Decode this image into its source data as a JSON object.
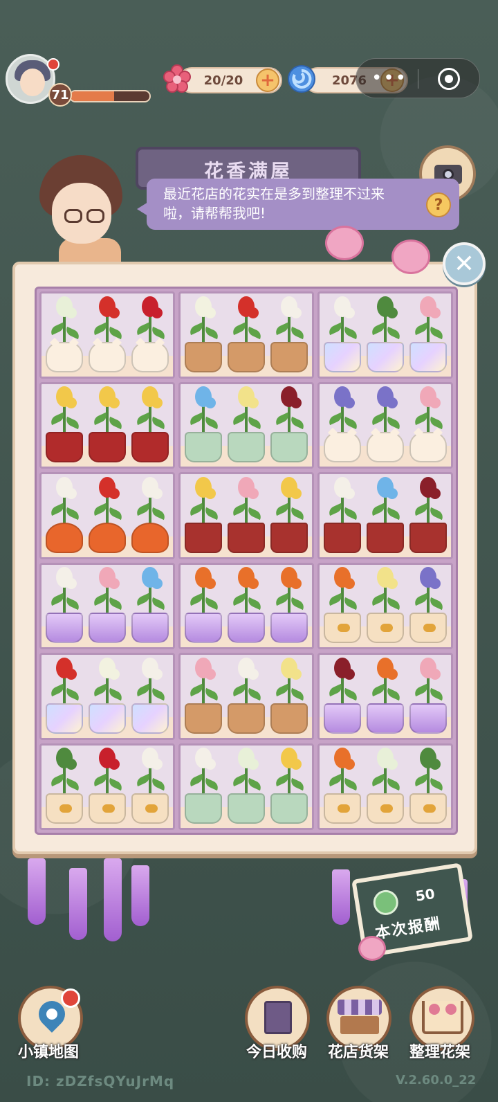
{
  "player": {
    "level": "71",
    "xp_fraction": 0.55
  },
  "resources": {
    "stamina": {
      "value": "20/20",
      "icon": "pink-flower-icon"
    },
    "currency": {
      "value": "2076",
      "icon": "blue-swirl-icon"
    }
  },
  "capsule": {
    "more_icon": "more-dots-icon",
    "close_icon": "target-icon"
  },
  "shop": {
    "title": "花香满屋"
  },
  "dialog": {
    "text": "最近花店的花实在是多到整理不过来啦，请帮帮我吧!"
  },
  "reward": {
    "value": "50",
    "label": "本次报酬"
  },
  "nav": {
    "map": "小镇地图",
    "purchase": "今日收购",
    "shelf": "花店货架",
    "organize": "整理花架"
  },
  "footer": {
    "id": "ID: zDZfsQYuJrMq",
    "version": "V.2.60.0_22"
  },
  "colors": {
    "panel_bg": "#f7eadc",
    "grid_bg": "#c7a3c7",
    "bubble": "#a48fc6"
  },
  "shelf": [
    [
      {
        "flower": "#e8f0d8",
        "pot": "cat"
      },
      {
        "flower": "#d4302a",
        "pot": "cat"
      },
      {
        "flower": "#c8202c",
        "pot": "cat"
      }
    ],
    [
      {
        "flower": "#f2f2e0",
        "pot": "clay"
      },
      {
        "flower": "#d4302a",
        "pot": "clay"
      },
      {
        "flower": "#f4f0e8",
        "pot": "clay"
      }
    ],
    [
      {
        "flower": "#f4f0e8",
        "pot": "glass"
      },
      {
        "flower": "#4f8a3e",
        "pot": "glass"
      },
      {
        "flower": "#f0a8b8",
        "pot": "glass"
      }
    ],
    [
      {
        "flower": "#f2c84a",
        "pot": "red"
      },
      {
        "flower": "#f2c84a",
        "pot": "red"
      },
      {
        "flower": "#f2c84a",
        "pot": "red"
      }
    ],
    [
      {
        "flower": "#6fb4e8",
        "pot": "jade"
      },
      {
        "flower": "#f2e28a",
        "pot": "jade"
      },
      {
        "flower": "#8a1f2a",
        "pot": "jade"
      }
    ],
    [
      {
        "flower": "#7a72c8",
        "pot": "cat"
      },
      {
        "flower": "#7a72c8",
        "pot": "cat"
      },
      {
        "flower": "#f0a8b8",
        "pot": "cat"
      }
    ],
    [
      {
        "flower": "#f4f0e8",
        "pot": "fire"
      },
      {
        "flower": "#d4302a",
        "pot": "fire"
      },
      {
        "flower": "#f4f0e8",
        "pot": "fire"
      }
    ],
    [
      {
        "flower": "#f2c84a",
        "pot": "terracotta"
      },
      {
        "flower": "#f0a8b8",
        "pot": "terracotta"
      },
      {
        "flower": "#f2c84a",
        "pot": "terracotta"
      }
    ],
    [
      {
        "flower": "#f4f0e8",
        "pot": "terracotta"
      },
      {
        "flower": "#6fb4e8",
        "pot": "terracotta"
      },
      {
        "flower": "#8a1f2a",
        "pot": "terracotta"
      }
    ],
    [
      {
        "flower": "#f4f0e8",
        "pot": "amethyst"
      },
      {
        "flower": "#f0a8b8",
        "pot": "amethyst"
      },
      {
        "flower": "#6fb4e8",
        "pot": "amethyst"
      }
    ],
    [
      {
        "flower": "#e8702a",
        "pot": "amethyst"
      },
      {
        "flower": "#e8702a",
        "pot": "amethyst"
      },
      {
        "flower": "#e8702a",
        "pot": "amethyst"
      }
    ],
    [
      {
        "flower": "#e8702a",
        "pot": "bow"
      },
      {
        "flower": "#f2e28a",
        "pot": "bow"
      },
      {
        "flower": "#7a72c8",
        "pot": "bow"
      }
    ],
    [
      {
        "flower": "#d4302a",
        "pot": "glass"
      },
      {
        "flower": "#f2f2e0",
        "pot": "glass"
      },
      {
        "flower": "#f4f0e8",
        "pot": "glass"
      }
    ],
    [
      {
        "flower": "#f0a8b8",
        "pot": "clay"
      },
      {
        "flower": "#f4f0e8",
        "pot": "clay"
      },
      {
        "flower": "#f2e28a",
        "pot": "clay"
      }
    ],
    [
      {
        "flower": "#8a1f2a",
        "pot": "amethyst"
      },
      {
        "flower": "#e8702a",
        "pot": "amethyst"
      },
      {
        "flower": "#f0a8b8",
        "pot": "amethyst"
      }
    ],
    [
      {
        "flower": "#4f8a3e",
        "pot": "bow"
      },
      {
        "flower": "#c8202c",
        "pot": "bow"
      },
      {
        "flower": "#f4f0e8",
        "pot": "bow"
      }
    ],
    [
      {
        "flower": "#f4f0e8",
        "pot": "jade"
      },
      {
        "flower": "#e8f0d8",
        "pot": "jade"
      },
      {
        "flower": "#f2c84a",
        "pot": "jade"
      }
    ],
    [
      {
        "flower": "#e8702a",
        "pot": "bow"
      },
      {
        "flower": "#e8f0d8",
        "pot": "bow"
      },
      {
        "flower": "#4f8a3e",
        "pot": "bow"
      }
    ]
  ]
}
